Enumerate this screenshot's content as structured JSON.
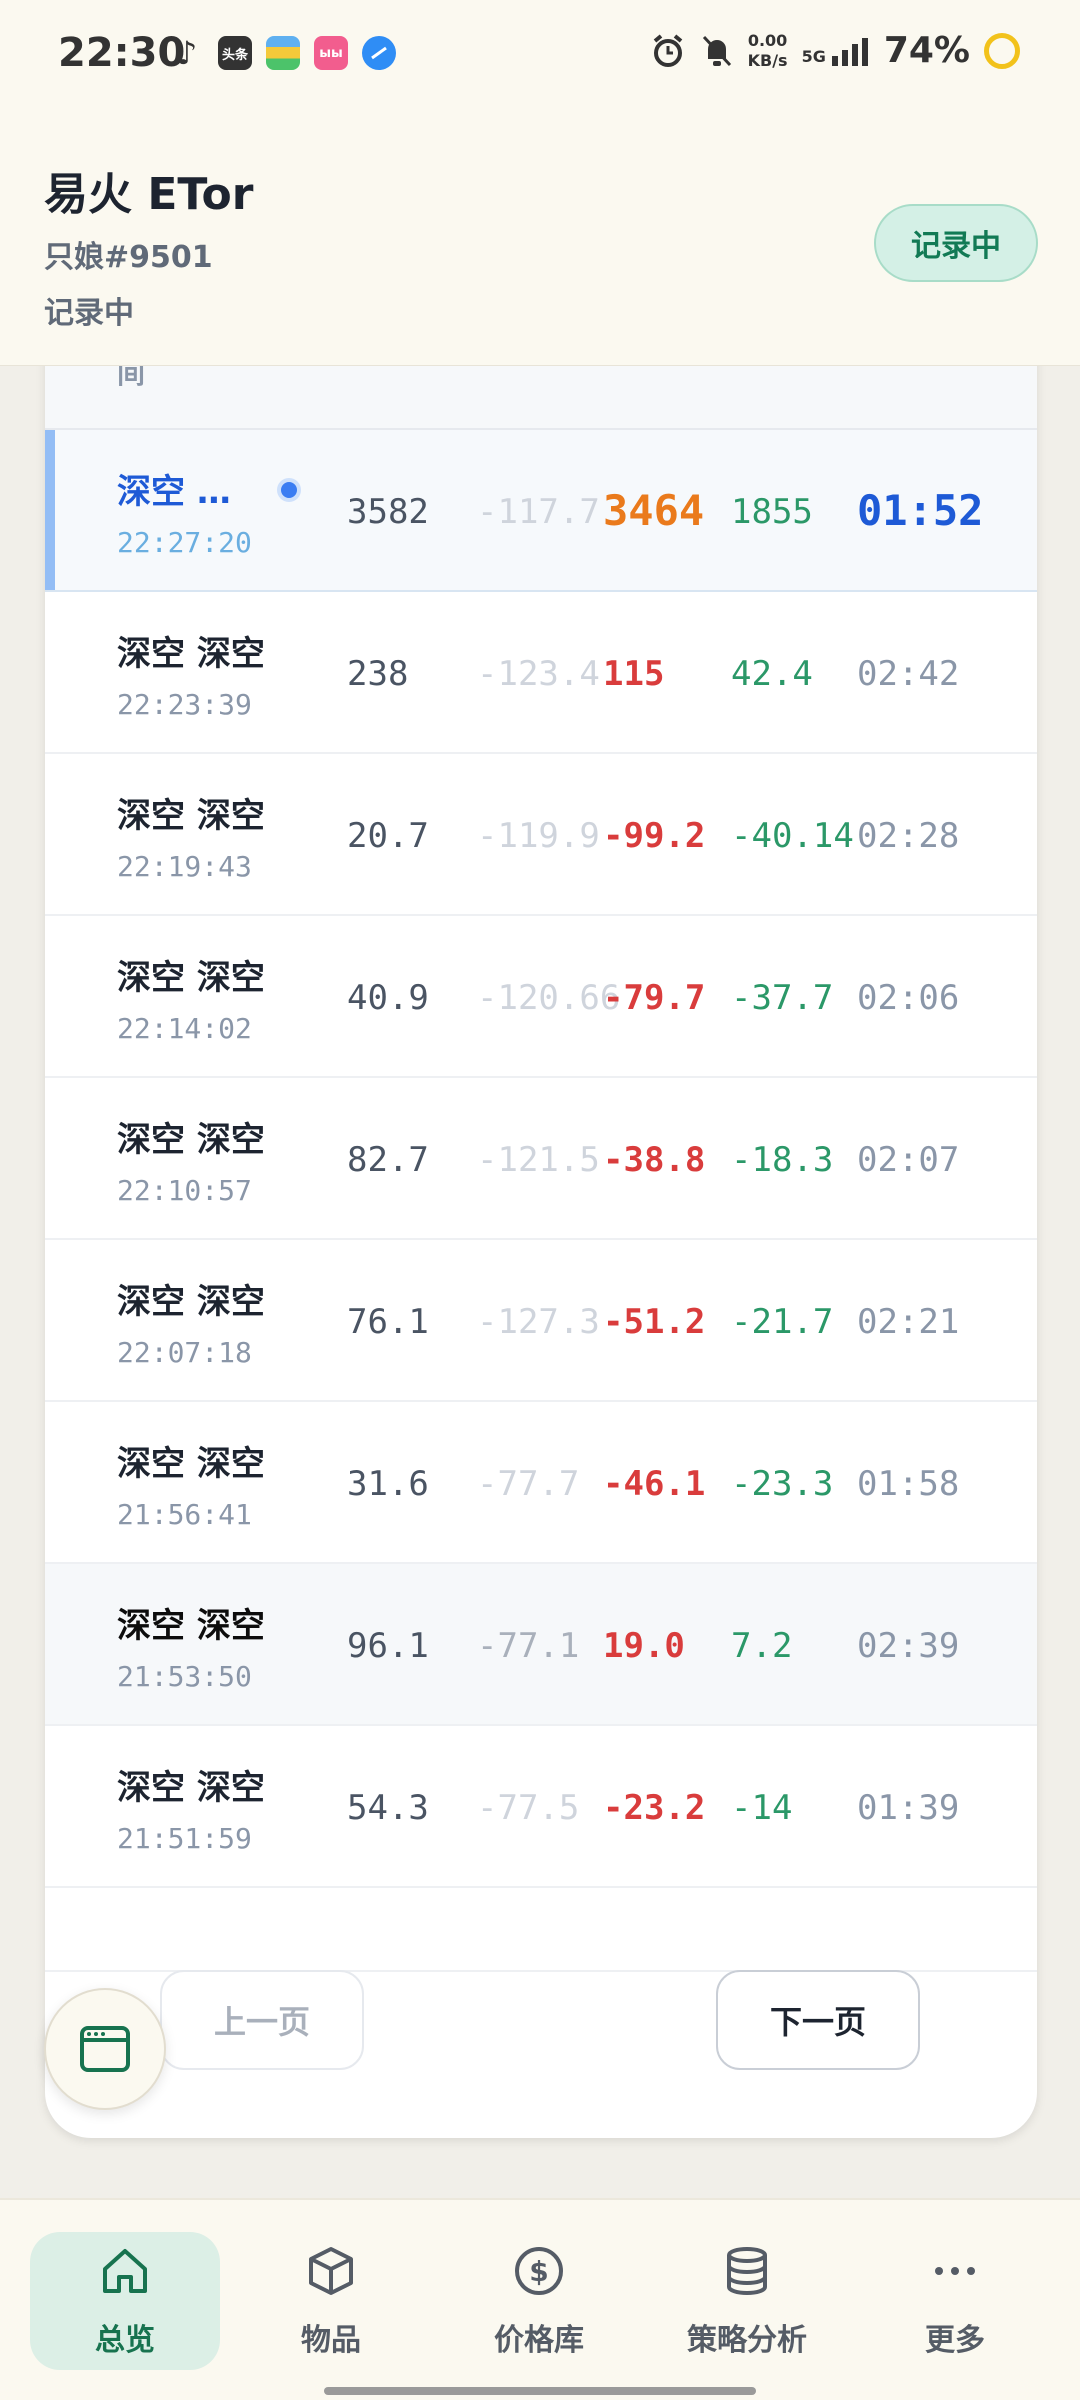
{
  "status_bar": {
    "time": "22:30",
    "apps": [
      "tiktok-icon",
      "toutiao-icon",
      "wallet-icon",
      "bilibili-icon",
      "browser-icon"
    ],
    "app_labels": {
      "toutiao": "头条",
      "bilibili": "ыы"
    },
    "net_speed_value": "0.00",
    "net_speed_unit": "KB/s",
    "network": "5G",
    "battery": "74%"
  },
  "header": {
    "title": "易火 ETor",
    "user": "只娘#9501",
    "status": "记录中",
    "record_button": "记录中"
  },
  "table": {
    "partial_header": "间",
    "rows": [
      {
        "name": "深空 …",
        "time": "22:27:20",
        "v1": "3582",
        "v2": "-117.7",
        "v3": "3464",
        "v4": "1855",
        "v5": "01:52",
        "state": "active"
      },
      {
        "name": "深空 深空",
        "time": "22:23:39",
        "v1": "238",
        "v2": "-123.4",
        "v3": "115",
        "v4": "42.4",
        "v5": "02:42",
        "state": "normal"
      },
      {
        "name": "深空 深空",
        "time": "22:19:43",
        "v1": "20.7",
        "v2": "-119.9",
        "v3": "-99.2",
        "v4": "-40.14",
        "v5": "02:28",
        "state": "normal"
      },
      {
        "name": "深空 深空",
        "time": "22:14:02",
        "v1": "40.9",
        "v2": "-120.66",
        "v3": "-79.7",
        "v4": "-37.7",
        "v5": "02:06",
        "state": "normal"
      },
      {
        "name": "深空 深空",
        "time": "22:10:57",
        "v1": "82.7",
        "v2": "-121.5",
        "v3": "-38.8",
        "v4": "-18.3",
        "v5": "02:07",
        "state": "normal"
      },
      {
        "name": "深空 深空",
        "time": "22:07:18",
        "v1": "76.1",
        "v2": "-127.3",
        "v3": "-51.2",
        "v4": "-21.7",
        "v5": "02:21",
        "state": "normal"
      },
      {
        "name": "深空 深空",
        "time": "21:56:41",
        "v1": "31.6",
        "v2": "-77.7",
        "v3": "-46.1",
        "v4": "-23.3",
        "v5": "01:58",
        "state": "normal"
      },
      {
        "name": "深空 深空",
        "time": "21:53:50",
        "v1": "96.1",
        "v2": "-77.1",
        "v3": "19.0",
        "v4": "7.2",
        "v5": "02:39",
        "state": "shaded"
      },
      {
        "name": "深空 深空",
        "time": "21:51:59",
        "v1": "54.3",
        "v2": "-77.5",
        "v3": "-23.2",
        "v4": "-14",
        "v5": "01:39",
        "state": "normal"
      }
    ]
  },
  "pagination": {
    "prev": "上一页",
    "next": "下一页"
  },
  "bottom_nav": [
    {
      "label": "总览",
      "icon": "home-icon",
      "active": true
    },
    {
      "label": "物品",
      "icon": "box-icon",
      "active": false
    },
    {
      "label": "价格库",
      "icon": "dollar-icon",
      "active": false
    },
    {
      "label": "策略分析",
      "icon": "database-icon",
      "active": false
    },
    {
      "label": "更多",
      "icon": "more-icon",
      "active": false
    }
  ],
  "colors": {
    "accent": "#17734f",
    "positive": "#d93c3c",
    "negative": "#2b9868",
    "highlight": "#ea7a1c",
    "blue": "#1e5ad6"
  }
}
